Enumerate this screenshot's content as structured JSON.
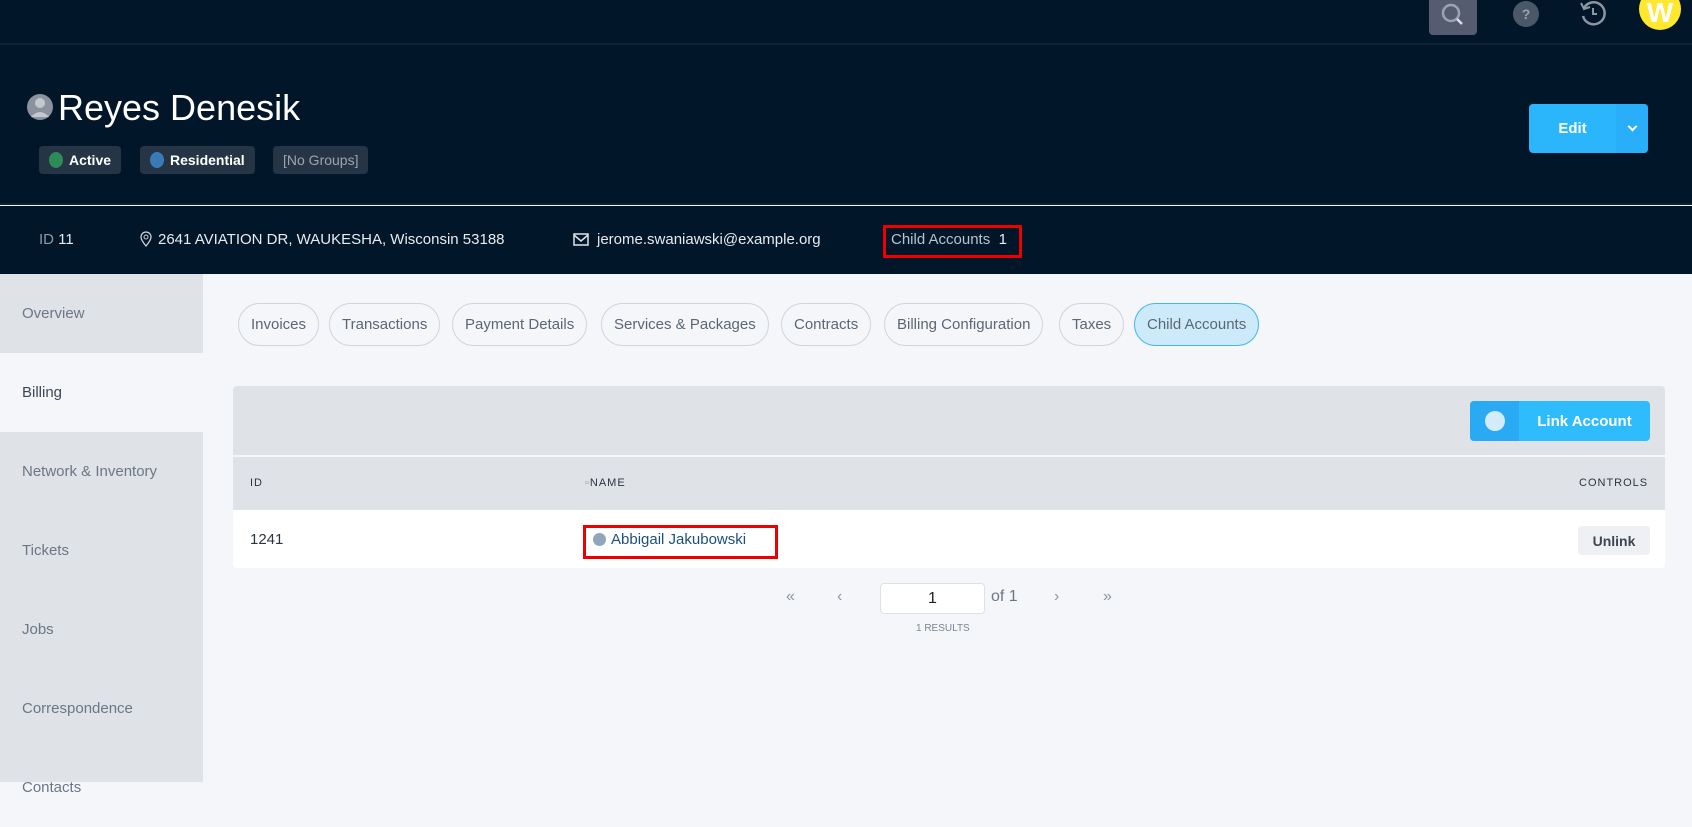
{
  "topbar": {
    "avatar_letter": "W"
  },
  "header": {
    "name": "Reyes Denesik",
    "badges": [
      {
        "label": "Active",
        "color": "#2e8b57"
      },
      {
        "label": "Residential",
        "color": "#3a7bb5"
      },
      {
        "label": "[No Groups]"
      }
    ],
    "edit_label": "Edit"
  },
  "info": {
    "id_label": "ID",
    "id_value": "11",
    "address": "2641 AVIATION DR, WAUKESHA, Wisconsin 53188",
    "email": "jerome.swaniawski@example.org",
    "child_label": "Child Accounts",
    "child_count": "1"
  },
  "sidebar": [
    "Overview",
    "Billing",
    "Network & Inventory",
    "Tickets",
    "Jobs",
    "Correspondence",
    "Contacts"
  ],
  "tabs": [
    "Invoices",
    "Transactions",
    "Payment Details",
    "Services & Packages",
    "Contracts",
    "Billing Configuration",
    "Taxes",
    "Child Accounts"
  ],
  "table": {
    "link_label": "Link Account",
    "headers": {
      "id": "ID",
      "name": "NAME",
      "controls": "CONTROLS"
    },
    "rows": [
      {
        "id": "1241",
        "name": "Abbigail Jakubowski",
        "action": "Unlink"
      }
    ]
  },
  "pagination": {
    "first": "«",
    "prev": "‹",
    "page": "1",
    "of": "of 1",
    "next": "›",
    "last": "»",
    "results": "1 RESULTS"
  },
  "colors": {
    "accent": "#2bb6fb",
    "dark": "#021629"
  }
}
